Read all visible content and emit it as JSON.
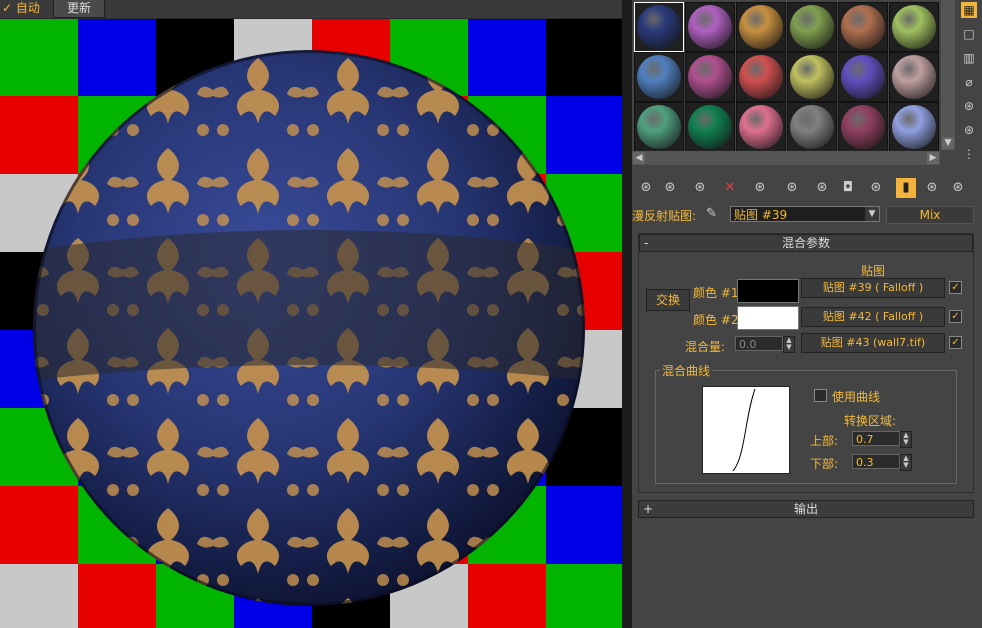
{
  "viewport": {
    "auto_label": "✓ 自动",
    "update_button": "更新",
    "checker_colors": [
      "#00b400",
      "#0000e6",
      "#000000",
      "#c8c8c8",
      "#e60000"
    ]
  },
  "material_slots": {
    "colors": [
      "#2a3a7a",
      "#b060c0",
      "#c89040",
      "#80a050",
      "#b07050",
      "#a0c060",
      "#5080c0",
      "#b05090",
      "#d05050",
      "#c0c060",
      "#6050c0",
      "#c0a0a0",
      "#50a080",
      "#108050",
      "#e07090",
      "#808080",
      "#904060",
      "#90a0e0"
    ]
  },
  "side_tools": [
    "▦",
    "□",
    "▥",
    "⌀",
    "⊛",
    "⊛",
    "⋮"
  ],
  "toolbar_icons": [
    "⊛",
    "⊛",
    "⊛",
    "✕",
    "⊛",
    "⊛",
    "⊛",
    "◘",
    "⊛",
    "▮",
    "⊛",
    "⊛"
  ],
  "map_row": {
    "label": "漫反射贴图:",
    "eyedropper": "✎",
    "map_name": "贴图 #39",
    "type_button": "Mix"
  },
  "mix_params": {
    "sign": "-",
    "title": "混合参数",
    "map_column_header": "贴图",
    "swap_button": "交换",
    "color1_label": "颜色 #1",
    "color1": "#000000",
    "color1_map": "贴图 #39 ( Falloff )",
    "color2_label": "颜色 #2",
    "color2": "#ffffff",
    "color2_map": "贴图 #42 ( Falloff )",
    "mix_amount_label": "混合量:",
    "mix_amount": "0.0",
    "mix_map": "贴图 #43 (wall7.tif)",
    "checks": [
      "✓",
      "✓",
      "✓"
    ]
  },
  "mix_curve": {
    "group_title": "混合曲线",
    "use_curve_label": "使用曲线",
    "transition_label": "转换区域:",
    "upper_label": "上部:",
    "upper_value": "0.7",
    "lower_label": "下部:",
    "lower_value": "0.3"
  },
  "output_rollout": {
    "sign": "+",
    "title": "输出"
  }
}
